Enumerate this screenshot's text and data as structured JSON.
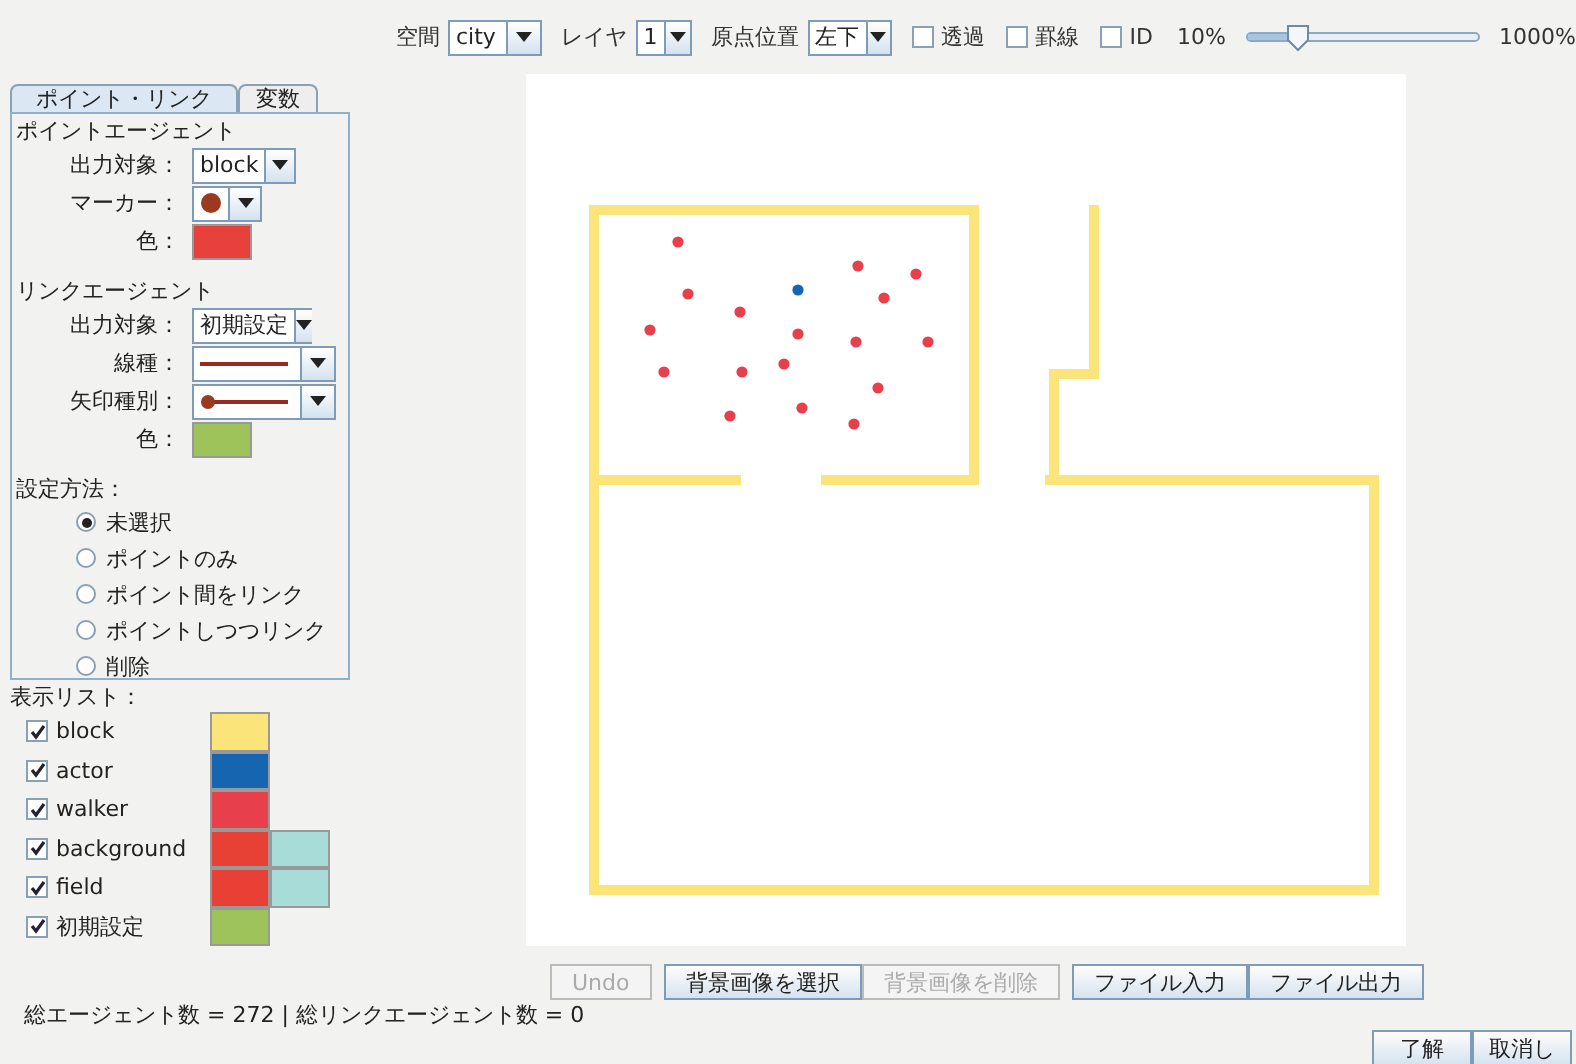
{
  "toolbar": {
    "space": {
      "label": "空間",
      "value": "city"
    },
    "layer": {
      "label": "レイヤ",
      "value": "1"
    },
    "origin": {
      "label": "原点位置",
      "value": "左下"
    },
    "checkboxes": [
      {
        "label": "透過",
        "checked": false
      },
      {
        "label": "罫線",
        "checked": false
      },
      {
        "label": "ID",
        "checked": false
      }
    ],
    "zoom": {
      "min_label": "10%",
      "max_label": "1000%",
      "level": 0.22
    }
  },
  "tabs": [
    {
      "label": "ポイント・リンク",
      "selected": true
    },
    {
      "label": "変数",
      "selected": false
    }
  ],
  "point_agent": {
    "title": "ポイントエージェント",
    "target": {
      "label": "出力対象：",
      "value": "block"
    },
    "marker": {
      "label": "マーカー："
    },
    "color": {
      "label": "色：",
      "color": "#e8403a"
    }
  },
  "link_agent": {
    "title": "リンクエージェント",
    "target": {
      "label": "出力対象：",
      "value": "初期設定"
    },
    "line_type": {
      "label": "線種："
    },
    "arrow_type": {
      "label": "矢印種別："
    },
    "color": {
      "label": "色：",
      "color": "#9dc35a"
    }
  },
  "setting_method": {
    "title": "設定方法：",
    "options": [
      {
        "label": "未選択",
        "selected": true
      },
      {
        "label": "ポイントのみ",
        "selected": false
      },
      {
        "label": "ポイント間をリンク",
        "selected": false
      },
      {
        "label": "ポイントしつつリンク",
        "selected": false
      },
      {
        "label": "削除",
        "selected": false
      }
    ]
  },
  "display_list": {
    "title": "表示リスト：",
    "items": [
      {
        "label": "block",
        "checked": true,
        "swatches": [
          {
            "color": "#fbe57a"
          }
        ]
      },
      {
        "label": "actor",
        "checked": true,
        "swatches": [
          {
            "color": "#1565b0"
          }
        ]
      },
      {
        "label": "walker",
        "checked": true,
        "swatches": [
          {
            "color": "#e8404a"
          }
        ]
      },
      {
        "label": "background",
        "checked": true,
        "swatches": [
          {
            "color": "#e84034"
          },
          {
            "color": "#a8dcd9"
          }
        ]
      },
      {
        "label": "field",
        "checked": true,
        "swatches": [
          {
            "color": "#e84034"
          },
          {
            "color": "#a8dcd9"
          }
        ]
      },
      {
        "label": "初期設定",
        "checked": true,
        "swatches": [
          {
            "color": "#9dc35a"
          }
        ]
      }
    ]
  },
  "status_bar": "総エージェント数 = 272  |  総リンクエージェント数 = 0",
  "buttons": [
    {
      "label": "Undo",
      "disabled": true
    },
    {
      "label": "背景画像を選択",
      "disabled": false
    },
    {
      "label": "背景画像を削除",
      "disabled": true
    },
    {
      "label": "ファイル入力",
      "disabled": false
    },
    {
      "label": "ファイル出力",
      "disabled": false
    }
  ],
  "dialog_buttons": [
    "了解",
    "取消し"
  ]
}
